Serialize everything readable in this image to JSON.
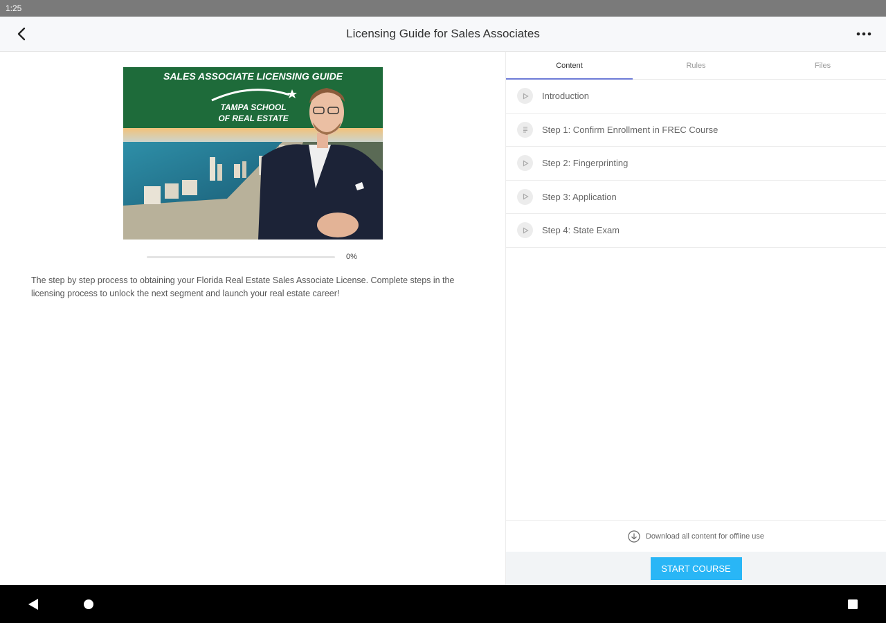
{
  "status_bar": {
    "time": "1:25"
  },
  "app_bar": {
    "title": "Licensing Guide for Sales Associates",
    "back_icon": "back-arrow-icon",
    "more_icon": "more-horizontal-icon"
  },
  "hero": {
    "banner_title": "SALES ASSOCIATE LICENSING GUIDE",
    "logo_line1": "TAMPA SCHOOL",
    "logo_line2": "OF REAL ESTATE",
    "banner_color": "#1e6b3a"
  },
  "progress": {
    "label": "0%",
    "value": 0
  },
  "description": "The step by step process to obtaining your Florida Real Estate Sales Associate License. Complete steps in the licensing process to unlock the next segment and launch your real estate career!",
  "tabs": [
    {
      "label": "Content",
      "active": true
    },
    {
      "label": "Rules",
      "active": false
    },
    {
      "label": "Files",
      "active": false
    }
  ],
  "lessons": [
    {
      "label": "Introduction",
      "icon": "play-icon"
    },
    {
      "label": "Step 1: Confirm Enrollment in FREC Course",
      "icon": "document-icon"
    },
    {
      "label": "Step 2: Fingerprinting",
      "icon": "play-icon"
    },
    {
      "label": "Step 3: Application",
      "icon": "play-icon"
    },
    {
      "label": "Step 4: State Exam",
      "icon": "play-icon"
    }
  ],
  "download_label": "Download all content for offline use",
  "start_button_label": "START COURSE",
  "colors": {
    "accent": "#29b6f6",
    "tab_indicator": "#6d7bd6"
  }
}
